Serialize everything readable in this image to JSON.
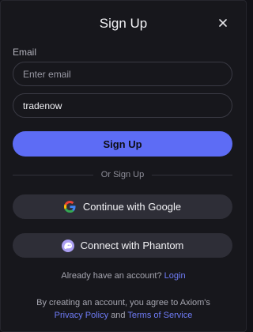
{
  "modal": {
    "title": "Sign Up",
    "email_label": "Email",
    "email_placeholder": "Enter email",
    "username_value": "tradenow",
    "signup_button": "Sign Up",
    "divider_text": "Or Sign Up",
    "google_button": "Continue with Google",
    "phantom_button": "Connect with Phantom",
    "already_text": "Already have an account?",
    "login_link": "Login",
    "terms_prefix": "By creating an account, you agree to Axiom's",
    "privacy_link": "Privacy Policy",
    "and_text": "and",
    "terms_link": "Terms of Service"
  },
  "icons": {
    "close": "close-icon",
    "google": "google-icon",
    "phantom": "phantom-icon"
  },
  "colors": {
    "background": "#17171c",
    "primary": "#5d6cf5",
    "link": "#6f7cf7",
    "secondary_button": "#2e2e37"
  }
}
